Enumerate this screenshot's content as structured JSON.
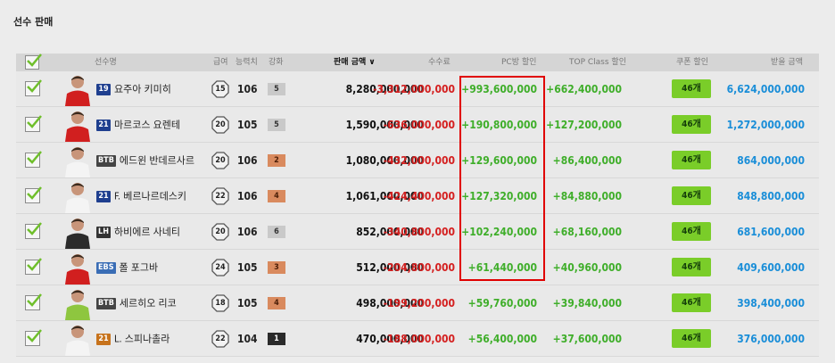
{
  "page": {
    "title": "선수 판매"
  },
  "header": {
    "name": "선수명",
    "grade": "급여",
    "ovr": "능력치",
    "enhance": "강화",
    "price": "판매 금액",
    "fee": "수수료",
    "pc_discount": "PC방 할인",
    "top_class": "TOP Class 할인",
    "coupon": "쿠폰 할인",
    "receive": "받을 금액"
  },
  "colors": {
    "fee": "#d42020",
    "discount": "#3fae2a",
    "receive": "#1a8ed8",
    "coupon_bg": "#7acd29",
    "highlight": "#e00000"
  },
  "rows": [
    {
      "season": "19",
      "season_color": "#1f3f8f",
      "name": "요주아 키미히",
      "grade": "15",
      "ovr": "106",
      "enh": "5",
      "enh_tier": "silver",
      "price": "8,280,000,000",
      "fee": "-3,312,000,000",
      "pc": "+993,600,000",
      "top": "+662,400,000",
      "coupon": "46개",
      "receive": "6,624,000,000",
      "kit": "red"
    },
    {
      "season": "21",
      "season_color": "#1f3f8f",
      "name": "마르코스 요렌테",
      "grade": "20",
      "ovr": "105",
      "enh": "5",
      "enh_tier": "silver",
      "price": "1,590,000,000",
      "fee": "-636,000,000",
      "pc": "+190,800,000",
      "top": "+127,200,000",
      "coupon": "46개",
      "receive": "1,272,000,000",
      "kit": "red"
    },
    {
      "season": "BTB",
      "season_color": "#444444",
      "name": "에드윈 반데르사르",
      "grade": "20",
      "ovr": "106",
      "enh": "2",
      "enh_tier": "bronze",
      "price": "1,080,000,000",
      "fee": "-432,000,000",
      "pc": "+129,600,000",
      "top": "+86,400,000",
      "coupon": "46개",
      "receive": "864,000,000",
      "kit": "white"
    },
    {
      "season": "21",
      "season_color": "#1f3f8f",
      "name": "F. 베르나르데스키",
      "grade": "22",
      "ovr": "106",
      "enh": "4",
      "enh_tier": "bronze",
      "price": "1,061,000,000",
      "fee": "-424,400,000",
      "pc": "+127,320,000",
      "top": "+84,880,000",
      "coupon": "46개",
      "receive": "848,800,000",
      "kit": "white"
    },
    {
      "season": "LH",
      "season_color": "#333333",
      "name": "하비에르 사네티",
      "grade": "20",
      "ovr": "106",
      "enh": "6",
      "enh_tier": "silver",
      "price": "852,000,000",
      "fee": "-340,800,000",
      "pc": "+102,240,000",
      "top": "+68,160,000",
      "coupon": "46개",
      "receive": "681,600,000",
      "kit": "dark"
    },
    {
      "season": "EBS",
      "season_color": "#3a6db5",
      "name": "폴 포그바",
      "grade": "24",
      "ovr": "105",
      "enh": "3",
      "enh_tier": "bronze",
      "price": "512,000,000",
      "fee": "-204,800,000",
      "pc": "+61,440,000",
      "top": "+40,960,000",
      "coupon": "46개",
      "receive": "409,600,000",
      "kit": "red"
    },
    {
      "season": "BTB",
      "season_color": "#444444",
      "name": "세르히오 리코",
      "grade": "18",
      "ovr": "105",
      "enh": "4",
      "enh_tier": "bronze",
      "price": "498,000,000",
      "fee": "-199,200,000",
      "pc": "+59,760,000",
      "top": "+39,840,000",
      "coupon": "46개",
      "receive": "398,400,000",
      "kit": "green"
    },
    {
      "season": "21",
      "season_color": "#c7731c",
      "name": "L. 스피나촐라",
      "grade": "22",
      "ovr": "104",
      "enh": "1",
      "enh_tier": "black",
      "price": "470,000,000",
      "fee": "-188,000,000",
      "pc": "+56,400,000",
      "top": "+37,600,000",
      "coupon": "46개",
      "receive": "376,000,000",
      "kit": "white"
    }
  ]
}
